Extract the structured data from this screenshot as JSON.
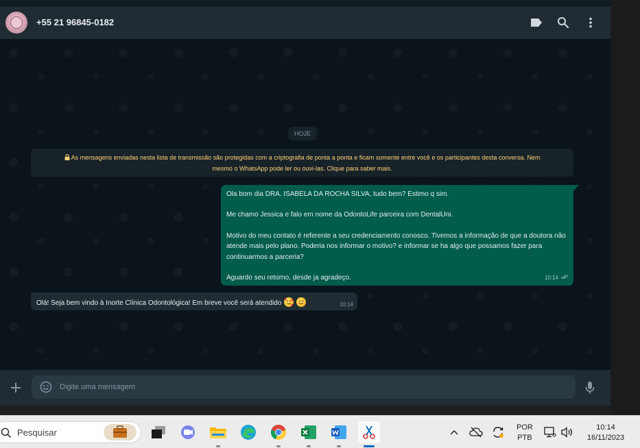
{
  "chat": {
    "contact_name": "+55 21 96845-0182",
    "date_label": "HOJE",
    "encryption_notice": {
      "line1": "As mensagens enviadas nesta lista de transmissão são protegidas com a criptografia de ponta a ponta e ficam somente entre você e os participantes desta conversa. Nem",
      "line2": "mesmo o WhatsApp pode ler ou ouvi-las. Clique para saber mais."
    },
    "outgoing_message": {
      "paragraphs": [
        "Ola bom dia DRA. ISABELA DA ROCHA SILVA, tudo bem? Estimo q sim.",
        "Me chamo Jessica e falo em nome da OdontoLife parceira com DentalUni.",
        "Motivo do meu contato é referente a seu credenciamento conosco. Tivemos a informação de que a doutora não atende mais pelo plano. Poderia nos informar o motivo? e informar se ha algo que possamos fazer para continuarmos a parceria?",
        "Aguardo seu retorno, desde ja agradeço."
      ],
      "time": "10:14",
      "status": "read"
    },
    "incoming_message": {
      "text": "Olá! Seja bem vindo à Inorte Clínica Odontológica! Em breve você será atendido",
      "emojis": [
        "smiling-face-with-hearts",
        "smiling-face"
      ],
      "time": "10:14"
    },
    "composer": {
      "placeholder": "Digite uma mensagem"
    }
  },
  "taskbar": {
    "search_placeholder": "Pesquisar",
    "apps": [
      "briefcase-icon",
      "task-view-icon",
      "teams-icon",
      "file-explorer-icon",
      "edge-icon",
      "chrome-icon",
      "excel-icon",
      "word-icon",
      "snipping-tool-icon"
    ],
    "language": {
      "line1": "POR",
      "line2": "PTB"
    },
    "clock": {
      "time": "10:14",
      "date": "16/11/2023"
    }
  },
  "colors": {
    "outgoing_bubble": "#005c4b",
    "incoming_bubble": "#202c33",
    "notice_text": "#ffd279",
    "header_bg": "#202c33",
    "chat_bg": "#0b141a"
  }
}
